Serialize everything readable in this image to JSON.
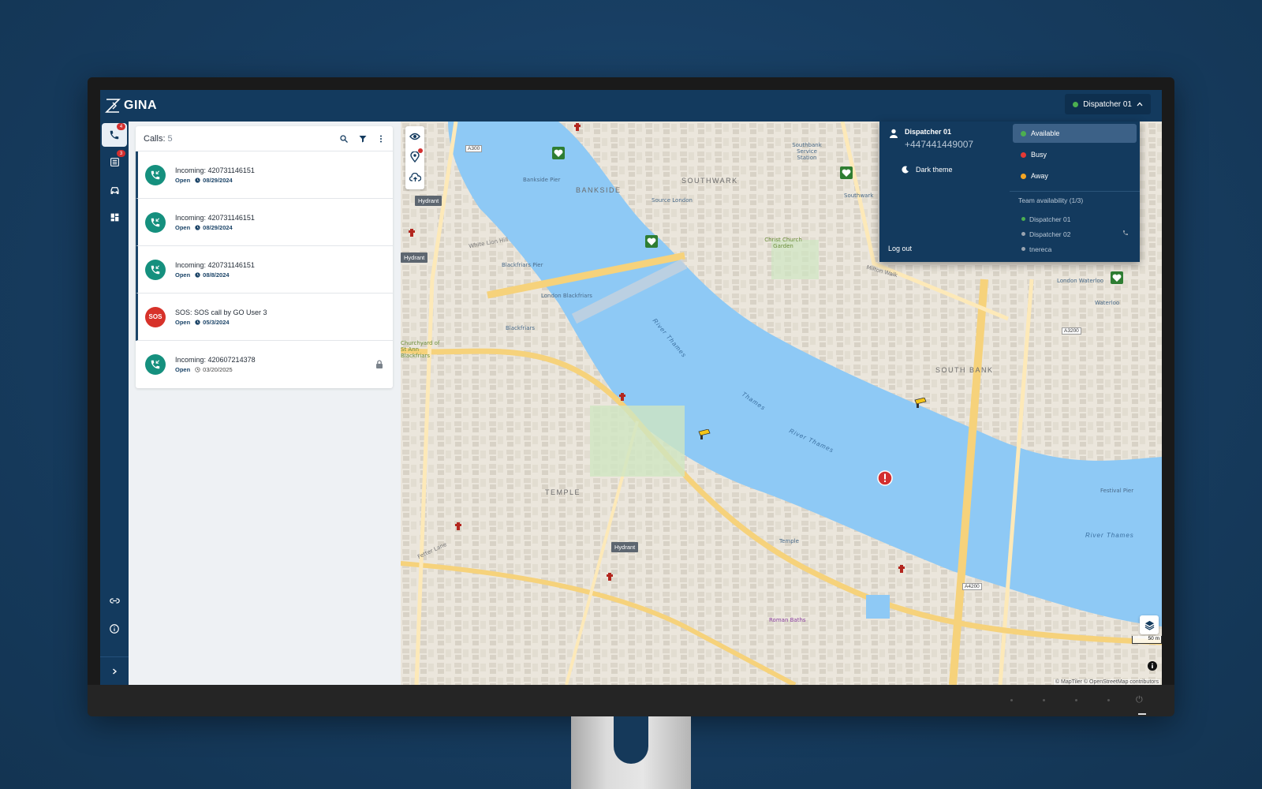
{
  "app": {
    "name": "GINA",
    "dispatcher_button_label": "Dispatcher 01"
  },
  "sidebar": {
    "items": [
      {
        "name": "calls",
        "badge": "4",
        "active": true
      },
      {
        "name": "reports",
        "badge": "3",
        "active": false
      },
      {
        "name": "vehicles",
        "badge": "",
        "active": false
      },
      {
        "name": "dashboard",
        "badge": "",
        "active": false
      }
    ]
  },
  "calls": {
    "title": "Calls:",
    "count": "5",
    "items": [
      {
        "title": "Incoming: 420731146151",
        "status": "Open",
        "date": "08/29/2024",
        "kind": "incoming",
        "locked": false
      },
      {
        "title": "Incoming: 420731146151",
        "status": "Open",
        "date": "08/29/2024",
        "kind": "incoming",
        "locked": false
      },
      {
        "title": "Incoming: 420731146151",
        "status": "Open",
        "date": "08/8/2024",
        "kind": "incoming",
        "locked": false
      },
      {
        "title": "SOS: SOS call by GO User 3",
        "status": "Open",
        "date": "05/3/2024",
        "kind": "sos",
        "avatar_label": "SOS",
        "locked": false
      },
      {
        "title": "Incoming: 420607214378",
        "status": "Open",
        "date": "03/20/2025",
        "kind": "incoming",
        "locked": true
      }
    ]
  },
  "dropdown": {
    "user_name": "Dispatcher 01",
    "user_phone": "+447441449007",
    "theme_label": "Dark theme",
    "logout_label": "Log out",
    "statuses": [
      {
        "label": "Available",
        "color": "#4caf50",
        "selected": true
      },
      {
        "label": "Busy",
        "color": "#e53935",
        "selected": false
      },
      {
        "label": "Away",
        "color": "#f5a623",
        "selected": false
      }
    ],
    "team_title": "Team availability (1/3)",
    "team": [
      {
        "name": "Dispatcher 01",
        "color": "#4caf50",
        "on_call": false
      },
      {
        "name": "Dispatcher 02",
        "color": "#9aa5b1",
        "on_call": true
      },
      {
        "name": "tnereca",
        "color": "#9aa5b1",
        "on_call": false
      }
    ]
  },
  "map": {
    "areas": [
      "BANKSIDE",
      "SOUTHWARK",
      "SOUTH BANK",
      "TEMPLE"
    ],
    "rivers": [
      "River Thames",
      "River Thames",
      "River Thames",
      "Thames"
    ],
    "places": [
      "Bankside Pier",
      "Source London",
      "Southbank Service Station",
      "Southwark",
      "Christ Church Garden",
      "Blackfriars Pier",
      "London Blackfriars",
      "Blackfriars",
      "Churchyard of St Ann Blackfriars",
      "London Waterloo",
      "Waterloo",
      "Festival Pier",
      "Temple",
      "Roman Baths",
      "White Lion Hill",
      "Fetter Lane",
      "Milton Walk"
    ],
    "roads": [
      "A300",
      "A3200",
      "A4200"
    ],
    "hydrant_label": "Hydrant",
    "scale": "50 m",
    "attribution": "© MapTiler © OpenStreetMap contributors"
  },
  "colors": {
    "navy": "#133a5e",
    "accent_teal": "#15907e",
    "sos_red": "#d7322a",
    "water": "#8ec9f5"
  }
}
